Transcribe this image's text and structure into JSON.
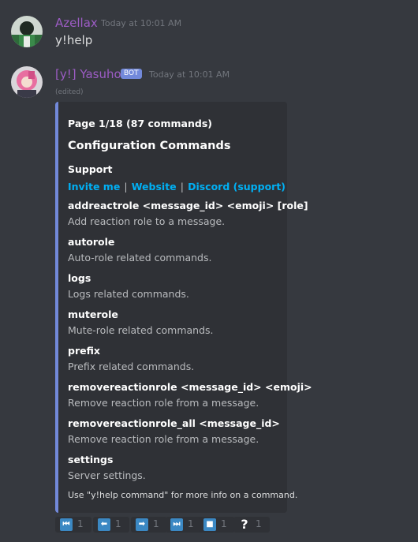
{
  "messages": [
    {
      "author": "Azellax",
      "author_color": "#9c5cc4",
      "timestamp": "Today at 10:01 AM",
      "content": "y!help"
    },
    {
      "author": "[y!] Yasuho",
      "author_color": "#9c5cc4",
      "bot_tag": "BOT",
      "timestamp": "Today at 10:01 AM",
      "edited": "(edited)"
    }
  ],
  "embed": {
    "accent": "#7289da",
    "page": "Page 1/18 (87 commands)",
    "title": "Configuration Commands",
    "support_label": "Support",
    "links": [
      "Invite me",
      "Website",
      "Discord (support)"
    ],
    "separator": "|",
    "fields": [
      {
        "name": "addreactrole <message_id> <emoji> [role]",
        "value": "Add reaction role to a message."
      },
      {
        "name": "autorole",
        "value": "Auto-role related commands."
      },
      {
        "name": "logs",
        "value": "Logs related commands."
      },
      {
        "name": "muterole",
        "value": "Mute-role related commands."
      },
      {
        "name": "prefix",
        "value": "Prefix related commands."
      },
      {
        "name": "removereactionrole <message_id> <emoji>",
        "value": "Remove reaction role from a message."
      },
      {
        "name": "removereactionrole_all <message_id>",
        "value": "Remove reaction role from a message."
      },
      {
        "name": "settings",
        "value": "Server settings."
      }
    ],
    "footer": "Use \"y!help command\" for more info on a command."
  },
  "reactions": [
    {
      "icon": "first-page-icon",
      "glyph": "⏮",
      "count": "1"
    },
    {
      "icon": "previous-page-icon",
      "glyph": "⬅",
      "count": "1"
    },
    {
      "icon": "next-page-icon",
      "glyph": "➡",
      "count": "1"
    },
    {
      "icon": "last-page-icon",
      "glyph": "⏭",
      "count": "1"
    },
    {
      "icon": "stop-icon",
      "glyph": "■",
      "count": "1"
    },
    {
      "icon": "question-icon",
      "glyph": "?",
      "count": "1"
    }
  ]
}
